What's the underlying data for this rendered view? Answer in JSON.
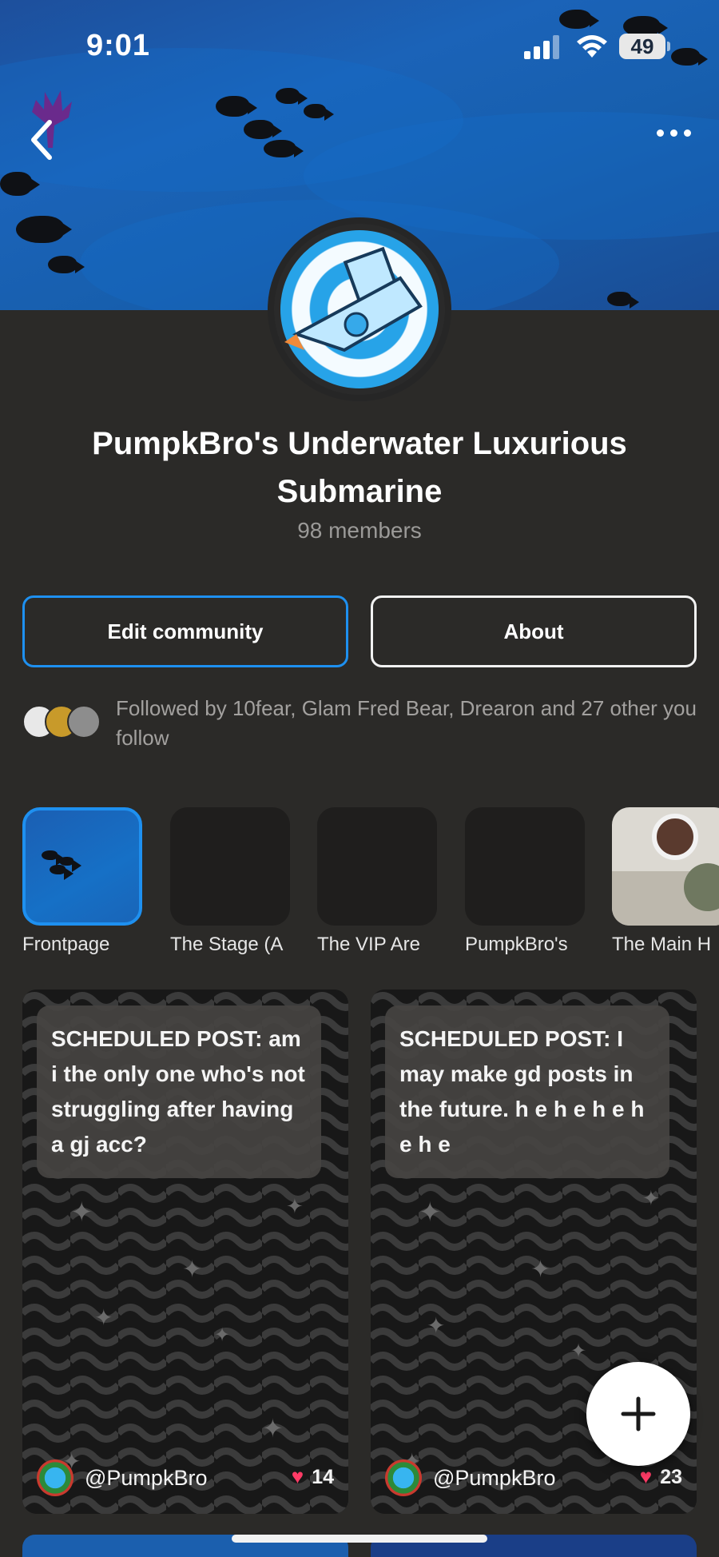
{
  "status_bar": {
    "time": "9:01",
    "battery": "49"
  },
  "community": {
    "title": "PumpkBro's Underwater Luxurious Submarine",
    "members": "98 members"
  },
  "actions": {
    "edit_label": "Edit community",
    "about_label": "About"
  },
  "followers_text": "Followed by 10fear, Glam Fred Bear, Drearon and 27 other you follow",
  "channels": [
    {
      "label": "Frontpage"
    },
    {
      "label": "The Stage (A"
    },
    {
      "label": "The VIP Are"
    },
    {
      "label": "PumpkBro's"
    },
    {
      "label": "The Main H"
    }
  ],
  "posts": [
    {
      "text": "SCHEDULED POST: am i the only one who's not struggling after having a gj acc?",
      "author": "@PumpkBro",
      "likes": "14"
    },
    {
      "text": "SCHEDULED POST: I may make gd posts in the future. h e h e h e h e h e",
      "author": "@PumpkBro",
      "likes": "23"
    }
  ],
  "colors": {
    "accent": "#1e90f0",
    "background": "#2b2a28",
    "heart": "#ff3b66"
  },
  "icons": {
    "back": "chevron-left-icon",
    "more": "more-icon",
    "add": "plus-icon",
    "like": "heart-icon"
  }
}
